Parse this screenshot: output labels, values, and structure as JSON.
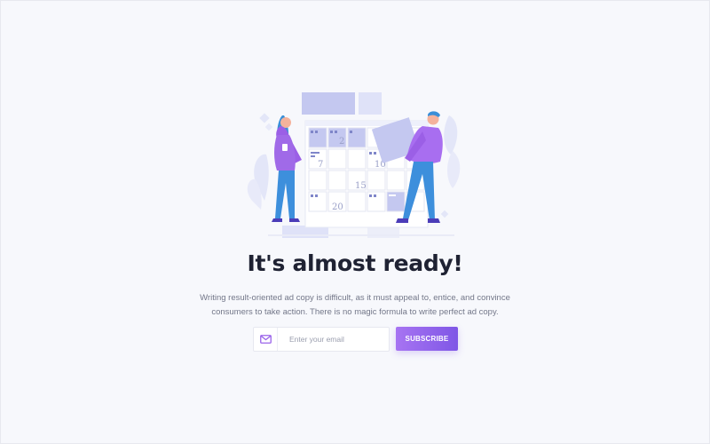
{
  "illustration": {
    "name": "calendar-illustration",
    "calendar_dates": [
      "2",
      "7",
      "10",
      "15",
      "20"
    ]
  },
  "headline": "It's almost ready!",
  "description": {
    "line1": "Writing result-oriented ad copy is difficult, as it must appeal to, entice, and convince",
    "line2": "consumers to take action. There is no magic formula to write perfect ad copy."
  },
  "form": {
    "email_icon": "envelope-icon",
    "email_placeholder": "Enter your email",
    "email_value": "",
    "subscribe_label": "SUBSCRIBE"
  },
  "colors": {
    "background": "#f7f8fc",
    "accent_start": "#a774f2",
    "accent_end": "#7f57e6",
    "calendar_fill": "#c4c8f0",
    "heading": "#1f2233",
    "body_text": "#737789"
  }
}
